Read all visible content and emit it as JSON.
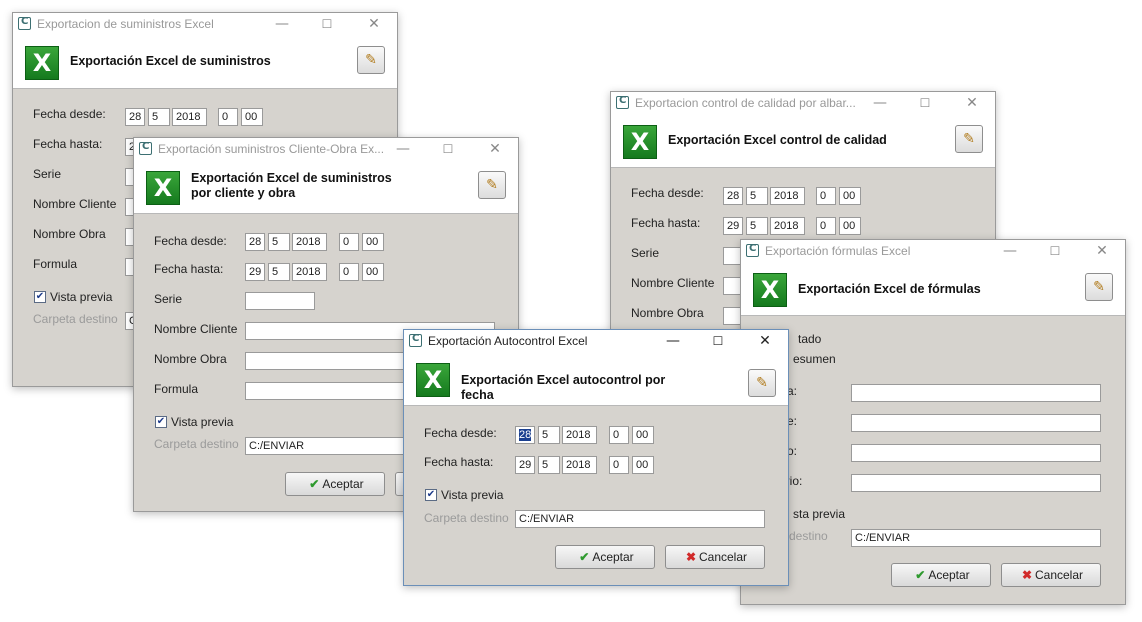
{
  "win1": {
    "title": "Exportacion de suministros Excel",
    "heading1": "Exportación Excel de suministros",
    "fecha_desde_label": "Fecha desde:",
    "fecha_hasta_label": "Fecha hasta:",
    "serie_label": "Serie",
    "nombre_cliente_label": "Nombre Cliente",
    "nombre_obra_label": "Nombre Obra",
    "formula_label": "Formula",
    "vista_previa_label": "Vista previa",
    "carpeta_label": "Carpeta destino",
    "desde": {
      "day": "28",
      "month": "5",
      "year": "2018",
      "hour": "0",
      "min": "00"
    },
    "hasta_day_partial": "2",
    "carpeta_partial": "C"
  },
  "win2": {
    "title": "Exportación suministros Cliente-Obra Ex...",
    "heading1": "Exportación Excel de suministros",
    "heading2": "por cliente y obra",
    "fecha_desde_label": "Fecha desde:",
    "fecha_hasta_label": "Fecha hasta:",
    "serie_label": "Serie",
    "nombre_cliente_label": "Nombre Cliente",
    "nombre_obra_label": "Nombre Obra",
    "formula_label": "Formula",
    "vista_previa_label": "Vista previa",
    "carpeta_label": "Carpeta destino",
    "carpeta_value": "C:/ENVIAR",
    "aceptar_label": "Aceptar",
    "desde": {
      "day": "28",
      "month": "5",
      "year": "2018",
      "hour": "0",
      "min": "00"
    },
    "hasta": {
      "day": "29",
      "month": "5",
      "year": "2018",
      "hour": "0",
      "min": "00"
    }
  },
  "win3": {
    "title": "Exportacion control de calidad por albar...",
    "heading1": "Exportación Excel control de calidad",
    "fecha_desde_label": "Fecha desde:",
    "fecha_hasta_label": "Fecha hasta:",
    "serie_label": "Serie",
    "nombre_cliente_label": "Nombre Cliente",
    "nombre_obra_label": "Nombre Obra",
    "desde": {
      "day": "28",
      "month": "5",
      "year": "2018",
      "hour": "0",
      "min": "00"
    },
    "hasta": {
      "day": "29",
      "month": "5",
      "year": "2018",
      "hour": "0",
      "min": "00"
    }
  },
  "win4": {
    "title": "Exportación fórmulas Excel",
    "heading1": "Exportación Excel de fórmulas",
    "labels_partial": [
      "tado",
      "esumen",
      "a:",
      "nte:",
      "ucto:",
      "ntario:"
    ],
    "vista_previa_partial": "sta previa",
    "carpeta_partial": "a destino",
    "carpeta_value": "C:/ENVIAR",
    "aceptar_label": "Aceptar",
    "cancelar_label": "Cancelar"
  },
  "win5": {
    "title": "Exportación Autocontrol Excel",
    "heading1": "Exportación Excel autocontrol por",
    "heading2": "fecha",
    "fecha_desde_label": "Fecha desde:",
    "fecha_hasta_label": "Fecha hasta:",
    "vista_previa_label": "Vista previa",
    "carpeta_label": "Carpeta destino",
    "carpeta_value": "C:/ENVIAR",
    "aceptar_label": "Aceptar",
    "cancelar_label": "Cancelar",
    "desde": {
      "day": "28",
      "month": "5",
      "year": "2018",
      "hour": "0",
      "min": "00"
    },
    "hasta": {
      "day": "29",
      "month": "5",
      "year": "2018",
      "hour": "0",
      "min": "00"
    }
  },
  "icons": {
    "app": "app-c-icon",
    "excel": "excel-icon",
    "edit": "edit-pencil-icon",
    "check": "checkmark-icon",
    "cancel": "cross-icon"
  },
  "window_controls": {
    "minimize": "—",
    "maximize": "☐",
    "close": "✕"
  }
}
